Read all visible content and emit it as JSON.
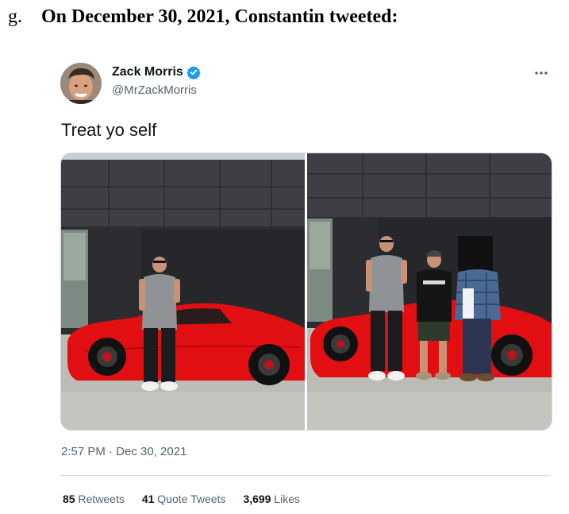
{
  "document": {
    "marker": "g.",
    "heading": "On December 30, 2021, Constantin tweeted:"
  },
  "tweet": {
    "display_name": "Zack Morris",
    "handle": "@MrZackMorris",
    "text": "Treat yo self",
    "timestamp": "2:57 PM · Dec 30, 2021",
    "stats": [
      {
        "count": "85",
        "label": "Retweets"
      },
      {
        "count": "41",
        "label": "Quote Tweets"
      },
      {
        "count": "3,699",
        "label": "Likes"
      }
    ],
    "icons": {
      "verified": "verified-badge-icon",
      "more": "more-options-icon"
    },
    "colors": {
      "verified": "#1d9bf0",
      "car": "#e10f12",
      "text_secondary": "#536471"
    }
  }
}
